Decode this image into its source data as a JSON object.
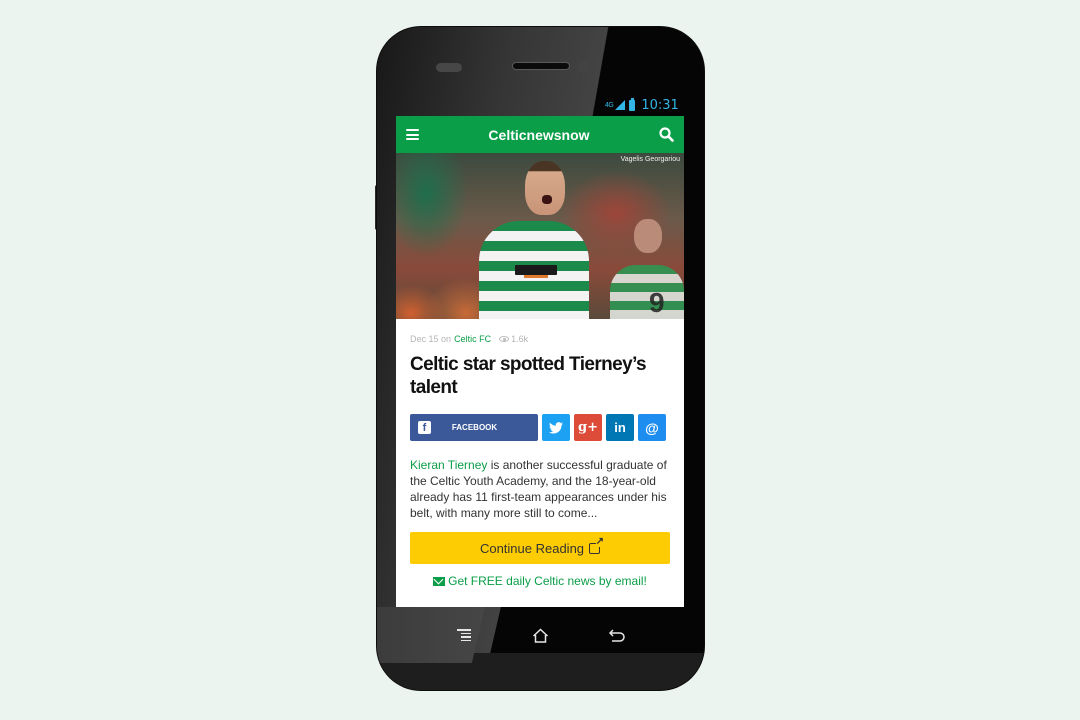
{
  "device": {
    "status_bar": {
      "network": "4G",
      "time": "10:31"
    },
    "nav_bar": {
      "recent_icon": "recent-apps-icon",
      "home_icon": "home-icon",
      "back_icon": "back-icon"
    }
  },
  "app": {
    "title": "Celticnewsnow",
    "menu_icon": "hamburger-icon",
    "search_icon": "search-icon",
    "brand_color": "#0a9e48"
  },
  "article": {
    "photo_credit": "Vagelis Georgariou",
    "meta": {
      "date": "Dec 15",
      "on": "on",
      "category": "Celtic FC",
      "views": "1.6k"
    },
    "headline": "Celtic star spotted Tierney’s talent",
    "share": {
      "facebook_label": "FACEBOOK",
      "twitter_glyph": "🐦",
      "googleplus_glyph": "g+",
      "linkedin_glyph": "in",
      "email_glyph": "@"
    },
    "excerpt": {
      "link_text": "Kieran Tierney",
      "body": " is another successful graduate of the Celtic Youth Academy, and the 18-year-old already has 11 first-team appearances under his belt, with many more still to come..."
    },
    "continue_label": "Continue Reading",
    "newsletter_label": "Get FREE daily Celtic news by email!"
  },
  "colors": {
    "facebook": "#3b5998",
    "twitter": "#1da1f2",
    "googleplus": "#dd4b39",
    "linkedin": "#0077b5",
    "email": "#1d8ef0",
    "cta": "#fecc02"
  }
}
